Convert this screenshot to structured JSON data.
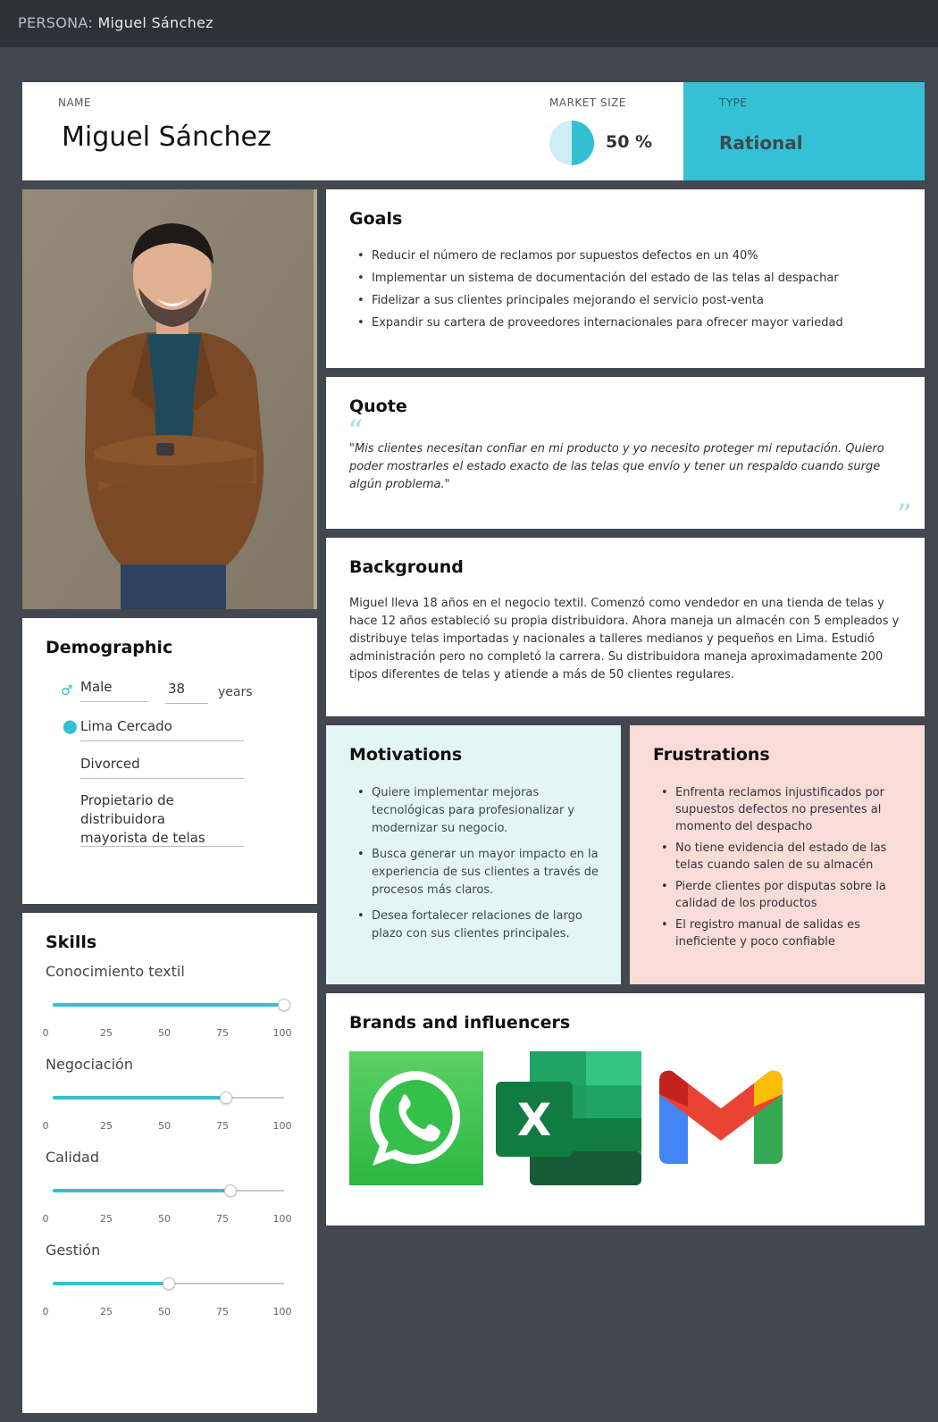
{
  "topbar": {
    "prefix": "PERSONA:",
    "name": "Miguel Sánchez"
  },
  "header": {
    "name_label": "NAME",
    "name": "Miguel Sánchez",
    "market_label": "MARKET SIZE",
    "market_value": "50 %",
    "market_fraction": 0.5,
    "type_label": "TYPE",
    "type_value": "Rational"
  },
  "colors": {
    "accent": "#34bfd3",
    "motivations_bg": "#e4f6f3",
    "frustrations_bg": "#f8dcd8",
    "page_bg": "#434750"
  },
  "goals": {
    "title": "Goals",
    "items": [
      "Reducir el número de reclamos por supuestos defectos en un 40%",
      "Implementar un sistema de documentación del estado de las telas al despachar",
      "Fidelizar a sus clientes principales mejorando el servicio post-venta",
      "Expandir su cartera de proveedores internacionales para ofrecer mayor variedad"
    ]
  },
  "quote": {
    "title": "Quote",
    "text": "\"Mis clientes necesitan confiar en mi producto y yo necesito proteger mi reputación. Quiero poder mostrarles el estado exacto de las telas que envío y tener un respaldo cuando surge algún problema.\""
  },
  "background": {
    "title": "Background",
    "text": "Miguel lleva 18 años en el negocio textil. Comenzó como vendedor en una tienda de telas y hace 12 años estableció su propia distribuidora. Ahora maneja un almacén con 5 empleados y distribuye telas importadas y nacionales a talleres medianos y pequeños en Lima. Estudió administración pero no completó la carrera. Su distribuidora maneja aproximadamente 200 tipos diferentes de telas y atiende a más de 50 clientes regulares."
  },
  "motivations": {
    "title": "Motivations",
    "items": [
      "Quiere implementar mejoras tecnológicas para profesionalizar y modernizar su negocio.",
      "Busca generar un mayor impacto en la experiencia de sus clientes a través de procesos más claros.",
      "Desea fortalecer relaciones de largo plazo con sus clientes principales."
    ]
  },
  "frustrations": {
    "title": "Frustrations",
    "items": [
      "Enfrenta reclamos injustificados por supuestos defectos no presentes al momento del despacho",
      "No tiene evidencia del estado de las telas cuando salen de su almacén",
      "Pierde clientes por disputas sobre la calidad de los productos",
      "El registro manual de salidas es ineficiente y poco confiable"
    ]
  },
  "brands": {
    "title": "Brands and influencers",
    "logos": [
      "whatsapp-logo",
      "excel-logo",
      "gmail-logo"
    ]
  },
  "demographic": {
    "title": "Demographic",
    "gender": "Male",
    "gender_icon": "male-icon",
    "age": "38",
    "age_unit": "years",
    "location_icon": "location-pin-icon",
    "location": "Lima Cercado",
    "marital_status": "Divorced",
    "occupation": "Propietario de distribuidora mayorista de telas"
  },
  "skills": {
    "title": "Skills",
    "ticks": [
      "0",
      "25",
      "50",
      "75",
      "100"
    ],
    "items": [
      {
        "name": "Conocimiento textil",
        "value": 100
      },
      {
        "name": "Negociación",
        "value": 75
      },
      {
        "name": "Calidad",
        "value": 77
      },
      {
        "name": "Gestión",
        "value": 50
      }
    ]
  }
}
